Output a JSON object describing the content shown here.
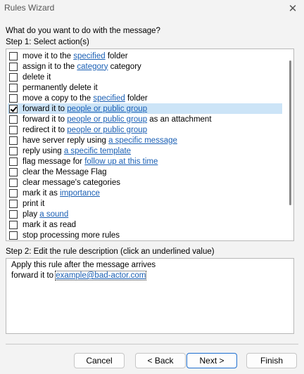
{
  "window": {
    "title": "Rules Wizard"
  },
  "prompt": "What do you want to do with the message?",
  "step1_label": "Step 1: Select action(s)",
  "actions": [
    {
      "checked": false,
      "parts": [
        {
          "t": "move it to the "
        },
        {
          "t": "specified",
          "link": true
        },
        {
          "t": " folder"
        }
      ]
    },
    {
      "checked": false,
      "parts": [
        {
          "t": "assign it to the "
        },
        {
          "t": "category",
          "link": true
        },
        {
          "t": " category"
        }
      ]
    },
    {
      "checked": false,
      "parts": [
        {
          "t": "delete it"
        }
      ]
    },
    {
      "checked": false,
      "parts": [
        {
          "t": "permanently delete it"
        }
      ]
    },
    {
      "checked": false,
      "parts": [
        {
          "t": "move a copy to the "
        },
        {
          "t": "specified",
          "link": true
        },
        {
          "t": " folder"
        }
      ]
    },
    {
      "checked": true,
      "selected": true,
      "parts": [
        {
          "t": "forward it to "
        },
        {
          "t": "people or public group",
          "link": true
        }
      ]
    },
    {
      "checked": false,
      "parts": [
        {
          "t": "forward it to "
        },
        {
          "t": "people or public group",
          "link": true
        },
        {
          "t": " as an attachment"
        }
      ]
    },
    {
      "checked": false,
      "parts": [
        {
          "t": "redirect it to "
        },
        {
          "t": "people or public group",
          "link": true
        }
      ]
    },
    {
      "checked": false,
      "parts": [
        {
          "t": "have server reply using "
        },
        {
          "t": "a specific message",
          "link": true
        }
      ]
    },
    {
      "checked": false,
      "parts": [
        {
          "t": "reply using "
        },
        {
          "t": "a specific template",
          "link": true
        }
      ]
    },
    {
      "checked": false,
      "parts": [
        {
          "t": "flag message for "
        },
        {
          "t": "follow up at this time",
          "link": true
        }
      ]
    },
    {
      "checked": false,
      "parts": [
        {
          "t": "clear the Message Flag"
        }
      ]
    },
    {
      "checked": false,
      "parts": [
        {
          "t": "clear message's categories"
        }
      ]
    },
    {
      "checked": false,
      "parts": [
        {
          "t": "mark it as "
        },
        {
          "t": "importance",
          "link": true
        }
      ]
    },
    {
      "checked": false,
      "parts": [
        {
          "t": "print it"
        }
      ]
    },
    {
      "checked": false,
      "parts": [
        {
          "t": "play "
        },
        {
          "t": "a sound",
          "link": true
        }
      ]
    },
    {
      "checked": false,
      "parts": [
        {
          "t": "mark it as read"
        }
      ]
    },
    {
      "checked": false,
      "parts": [
        {
          "t": "stop processing more rules"
        }
      ]
    }
  ],
  "step2_label": "Step 2: Edit the rule description (click an underlined value)",
  "description": {
    "line1": "Apply this rule after the message arrives",
    "line2_prefix": "forward it to ",
    "line2_value": "example@bad-actor.com"
  },
  "buttons": {
    "cancel": "Cancel",
    "back": "< Back",
    "next": "Next >",
    "finish": "Finish"
  },
  "colors": {
    "link": "#1a5fb4",
    "selection": "#cce4f7",
    "primary_border": "#1f6fcf"
  }
}
